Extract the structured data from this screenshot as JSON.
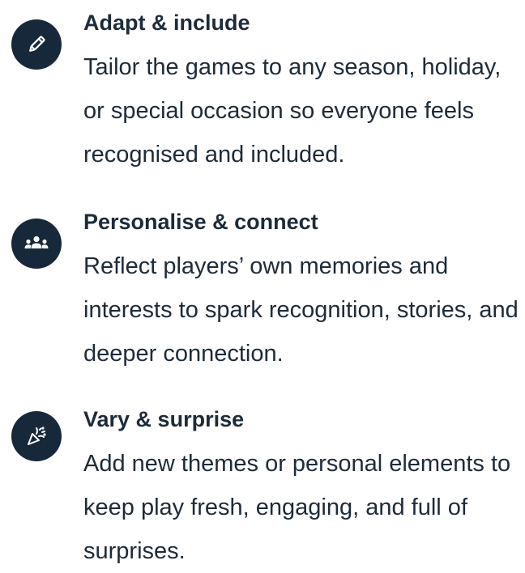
{
  "features": [
    {
      "icon": "pencil-icon",
      "title": "Adapt & include",
      "description": "Tailor the games to any season, holiday, or special occasion so everyone feels recognised and included."
    },
    {
      "icon": "people-group-icon",
      "title": "Personalise & connect",
      "description": "Reflect players’ own memories and interests to spark recognition, stories, and deeper connection."
    },
    {
      "icon": "party-popper-icon",
      "title": "Vary & surprise",
      "description": "Add new themes or personal elements to keep play fresh, engaging, and full of surprises."
    }
  ],
  "colors": {
    "icon_background": "#16283a",
    "text": "#1d2b3a"
  }
}
